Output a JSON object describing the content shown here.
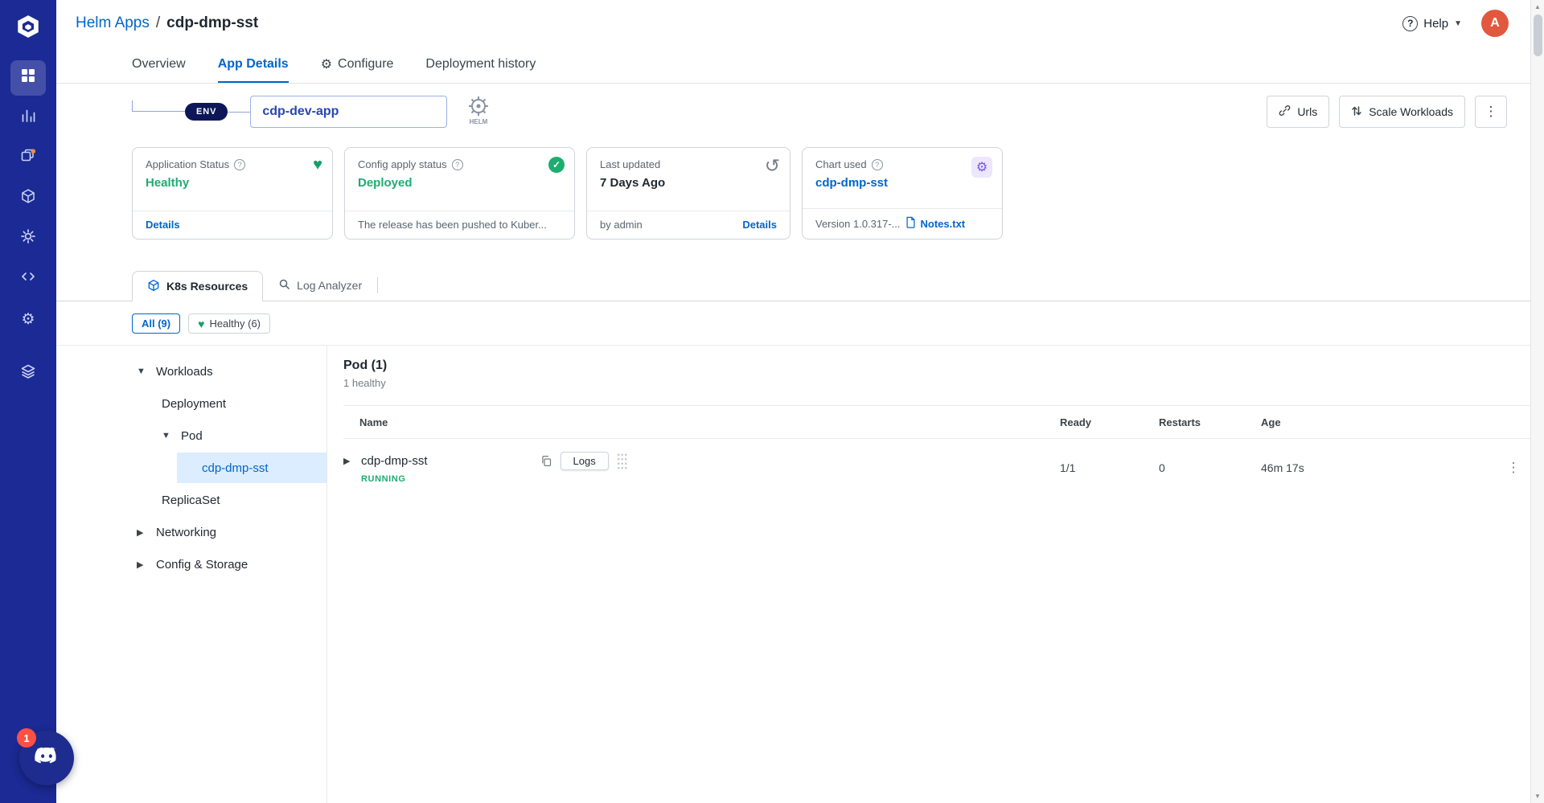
{
  "colors": {
    "primary_blue": "#0066CC",
    "sidebar_blue": "#1B2A94",
    "status_green": "#1DAD70",
    "chart_purple": "#7356E8",
    "avatar_orange": "#E1583E",
    "badge_red": "#FF5043"
  },
  "sidebar": {
    "icons": [
      "devtron-logo",
      "grid-icon",
      "chart-columns-icon",
      "jobs-icon",
      "cube-icon",
      "gear-sun-icon",
      "code-icon",
      "gear-icon",
      "layers-icon"
    ],
    "active_item": "applications"
  },
  "header": {
    "breadcrumb": {
      "parent": "Helm Apps",
      "separator": "/",
      "current": "cdp-dmp-sst"
    },
    "help": "Help",
    "avatar": "A"
  },
  "nav_tabs": {
    "overview": "Overview",
    "app_details": "App Details",
    "configure": "Configure",
    "deployment_history": "Deployment history"
  },
  "app_bar": {
    "env_badge": "ENV",
    "app_name": "cdp-dev-app",
    "urls": "Urls",
    "scale_workloads": "Scale Workloads"
  },
  "cards": {
    "application_status": {
      "title": "Application Status",
      "value": "Healthy",
      "link": "Details"
    },
    "config_apply": {
      "title": "Config apply status",
      "value": "Deployed",
      "footer": "The release has been pushed to Kuber..."
    },
    "last_updated": {
      "title": "Last updated",
      "value": "7 Days Ago",
      "footer": "by admin",
      "link": "Details"
    },
    "chart_used": {
      "title": "Chart used",
      "value": "cdp-dmp-sst",
      "footer": "Version 1.0.317-...",
      "link": "Notes.txt"
    }
  },
  "resource_tabs": {
    "k8s": "K8s Resources",
    "log_analyzer": "Log Analyzer"
  },
  "filters": {
    "all": "All (9)",
    "healthy": "Healthy (6)"
  },
  "tree": {
    "items": [
      {
        "label": "Workloads",
        "level": 0,
        "caret": "down",
        "selected": false
      },
      {
        "label": "Deployment",
        "level": 1,
        "caret": "none",
        "selected": false
      },
      {
        "label": "Pod",
        "level": 1,
        "caret": "down",
        "selected": false
      },
      {
        "label": "cdp-dmp-sst",
        "level": 2,
        "caret": "none",
        "selected": true
      },
      {
        "label": "ReplicaSet",
        "level": 1,
        "caret": "none",
        "selected": false
      },
      {
        "label": "Networking",
        "level": 0,
        "caret": "right",
        "selected": false
      },
      {
        "label": "Config & Storage",
        "level": 0,
        "caret": "right",
        "selected": false
      }
    ]
  },
  "pod_section": {
    "title": "Pod (1)",
    "subtitle": "1 healthy",
    "columns": {
      "name": "Name",
      "ready": "Ready",
      "restarts": "Restarts",
      "age": "Age"
    },
    "rows": [
      {
        "name": "cdp-dmp-sst",
        "status": "RUNNING",
        "logs": "Logs",
        "ready": "1/1",
        "restarts": "0",
        "age": "46m 17s"
      }
    ]
  },
  "floating": {
    "discord_badge": "1"
  }
}
